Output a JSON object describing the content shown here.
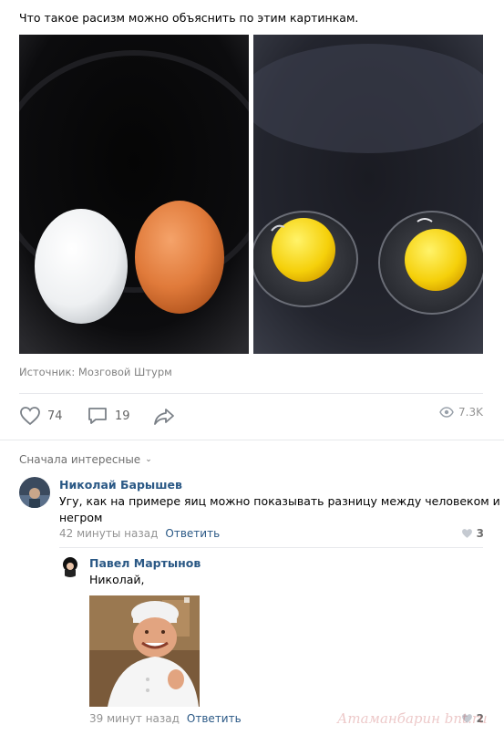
{
  "post": {
    "text": "Что такое расизм можно объяснить по этим картинкам.",
    "source": "Источник: Мозговой Штурм"
  },
  "actions": {
    "likes": "74",
    "comments": "19",
    "views": "7.3K"
  },
  "comments_sort": {
    "label": "Сначала интересные"
  },
  "comments": [
    {
      "author": "Николай Барышев",
      "text_line1": "Угу, как на примере яиц можно показывать разницу между человеком и",
      "text_line2": "негром",
      "time": "42 минуты назад",
      "reply_label": "Ответить",
      "likes": "3"
    },
    {
      "author": "Павел Мартынов",
      "text": "Николай,",
      "time": "39 минут назад",
      "reply_label": "Ответить",
      "likes": "2"
    }
  ],
  "watermark": "Атаманбарин bnt.ru",
  "colors": {
    "link": "#2a5885",
    "muted": "#939393",
    "divider": "#e7e8ec"
  }
}
